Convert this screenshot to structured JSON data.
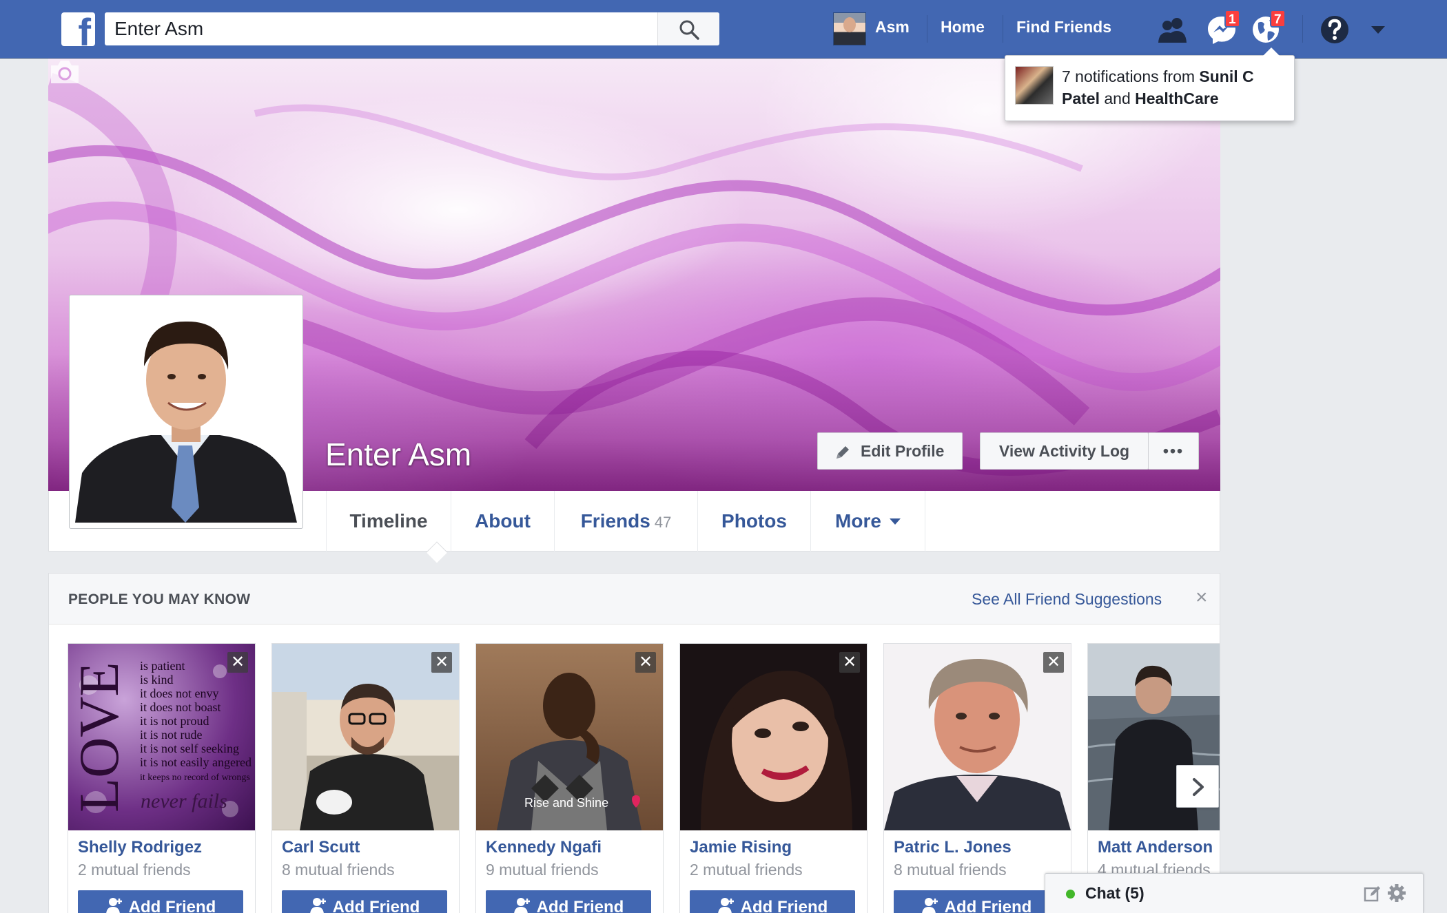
{
  "topbar": {
    "logo_letter": "f",
    "search_value": "Enter Asm",
    "user_name": "Asm",
    "home": "Home",
    "find_friends": "Find Friends",
    "messages_badge": "1",
    "notifications_badge": "7",
    "brand_color": "#4267b2"
  },
  "notification_popup": {
    "prefix": "7 notifications from ",
    "name1": "Sunil C Patel",
    "connector": " and ",
    "name2": "HealthCare"
  },
  "profile": {
    "name": "Enter Asm",
    "edit_profile": "Edit Profile",
    "view_activity_log": "View Activity Log",
    "more_dots": "•••"
  },
  "tabs": [
    {
      "label": "Timeline",
      "count": ""
    },
    {
      "label": "About",
      "count": ""
    },
    {
      "label": "Friends",
      "count": "47"
    },
    {
      "label": "Photos",
      "count": ""
    },
    {
      "label": "More",
      "count": ""
    }
  ],
  "pymk": {
    "title": "PEOPLE YOU MAY KNOW",
    "see_all": "See All Friend Suggestions",
    "close": "×",
    "add_friend_label": "Add Friend",
    "people": [
      {
        "name": "Shelly Rodrigez",
        "mutual": "2 mutual friends"
      },
      {
        "name": "Carl Scutt",
        "mutual": "8 mutual friends"
      },
      {
        "name": "Kennedy Ngafi",
        "mutual": "9 mutual friends"
      },
      {
        "name": "Jamie Rising",
        "mutual": "2 mutual friends"
      },
      {
        "name": "Patric L. Jones",
        "mutual": "8 mutual friends"
      },
      {
        "name": "Matt Anderson",
        "mutual": "4 mutual friends"
      }
    ],
    "love_image_text": [
      "LOVE",
      "is patient",
      "is kind",
      "it does not envy",
      "it does not boast",
      "it is not proud",
      "it is not rude",
      "it is not self seeking",
      "it is not easily angered",
      "it keeps no record of wrongs",
      "never fails"
    ],
    "kennedy_image_caption": "Rise and Shine"
  },
  "chat": {
    "label": "Chat (5)"
  }
}
